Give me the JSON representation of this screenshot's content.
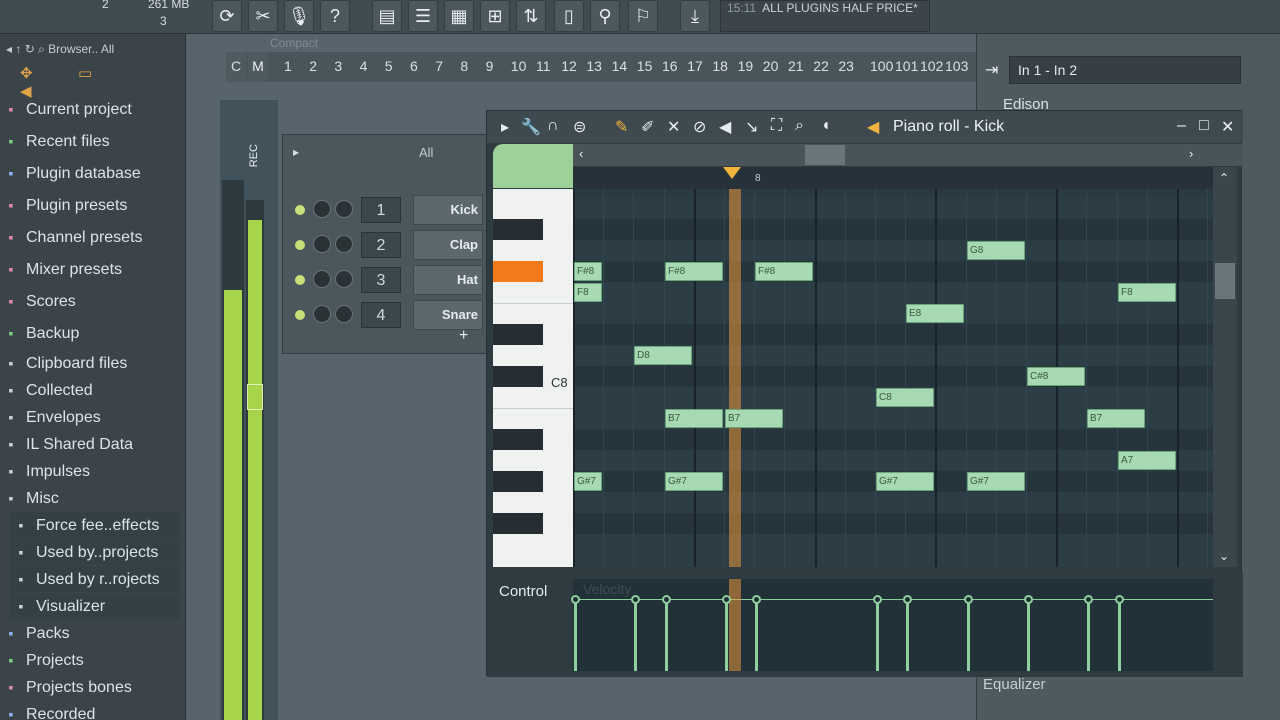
{
  "toolbar": {
    "counter": "2",
    "memory": "261 MB",
    "voices": "3",
    "hint_time": "15:11",
    "hint_text": "ALL PLUGINS HALF PRICE*"
  },
  "browser": {
    "header": "Browser.. All",
    "items": [
      {
        "label": "Current project",
        "icon": "project-icon",
        "color": "#e58aa8"
      },
      {
        "label": "Recent files",
        "icon": "recent-icon",
        "color": "#7fd17f"
      },
      {
        "label": "Plugin database",
        "icon": "plugin-db-icon",
        "color": "#8fb3ff"
      },
      {
        "label": "Plugin presets",
        "icon": "plugin-presets-icon",
        "color": "#e58aa8"
      },
      {
        "label": "Channel presets",
        "icon": "channel-presets-icon",
        "color": "#e58aa8"
      },
      {
        "label": "Mixer presets",
        "icon": "mixer-presets-icon",
        "color": "#e58aa8"
      },
      {
        "label": "Scores",
        "icon": "scores-icon",
        "color": "#e58aa8"
      },
      {
        "label": "Backup",
        "icon": "backup-icon",
        "color": "#7fd17f"
      },
      {
        "label": "Clipboard files",
        "icon": "folder-icon",
        "color": "#c9d3d8"
      },
      {
        "label": "Collected",
        "icon": "folder-icon",
        "color": "#c9d3d8"
      },
      {
        "label": "Envelopes",
        "icon": "folder-icon",
        "color": "#c9d3d8"
      },
      {
        "label": "IL Shared Data",
        "icon": "folder-icon",
        "color": "#c9d3d8"
      },
      {
        "label": "Impulses",
        "icon": "folder-icon",
        "color": "#c9d3d8"
      },
      {
        "label": "Misc",
        "icon": "folder-icon",
        "color": "#c9d3d8"
      }
    ],
    "subitems": [
      {
        "label": "Force fee..effects"
      },
      {
        "label": "Used by..projects"
      },
      {
        "label": "Used by r..rojects"
      },
      {
        "label": "Visualizer"
      }
    ],
    "bottom": [
      {
        "label": "Packs",
        "icon": "packs-icon",
        "color": "#8fb3ff"
      },
      {
        "label": "Projects",
        "icon": "projects-icon",
        "color": "#7fd17f"
      },
      {
        "label": "Projects bones",
        "icon": "projects-bones-icon",
        "color": "#e58aa8"
      },
      {
        "label": "Recorded",
        "icon": "recorded-icon",
        "color": "#8fb3ff"
      }
    ]
  },
  "playlist": {
    "mode": "Compact",
    "bars": [
      "1",
      "2",
      "3",
      "4",
      "5",
      "6",
      "7",
      "8",
      "9",
      "10",
      "11",
      "12",
      "13",
      "14",
      "15",
      "16",
      "17",
      "18",
      "19",
      "20",
      "21",
      "22",
      "23"
    ],
    "bars_right": [
      "100",
      "101",
      "102",
      "103"
    ]
  },
  "channel_rack": {
    "filter": "All",
    "channels": [
      {
        "num": "1",
        "name": "Kick"
      },
      {
        "num": "2",
        "name": "Clap"
      },
      {
        "num": "3",
        "name": "Hat"
      },
      {
        "num": "4",
        "name": "Snare"
      }
    ],
    "add": "+"
  },
  "mixer_strip": {
    "c_label": "C",
    "m_label": "M",
    "rec_label": "REC"
  },
  "piano_roll": {
    "title": "Piano roll - Kick",
    "position_marker": "8",
    "c8_label": "C8",
    "control_label": "Control",
    "control_target": "Velocity"
  },
  "notes": [
    {
      "pitch": "F#8",
      "col": 0,
      "len": 1
    },
    {
      "pitch": "F#8",
      "col": 3,
      "len": 2
    },
    {
      "pitch": "F#8",
      "col": 6,
      "len": 2
    },
    {
      "pitch": "F8",
      "col": 0,
      "len": 1
    },
    {
      "pitch": "G8",
      "col": 13,
      "len": 2
    },
    {
      "pitch": "F8",
      "col": 18,
      "len": 2
    },
    {
      "pitch": "E8",
      "col": 11,
      "len": 2
    },
    {
      "pitch": "D8",
      "col": 2,
      "len": 2
    },
    {
      "pitch": "C#8",
      "col": 15,
      "len": 2
    },
    {
      "pitch": "C8",
      "col": 10,
      "len": 2
    },
    {
      "pitch": "B7",
      "col": 3,
      "len": 2
    },
    {
      "pitch": "B7",
      "col": 5,
      "len": 2
    },
    {
      "pitch": "B7",
      "col": 17,
      "len": 2
    },
    {
      "pitch": "A7",
      "col": 18,
      "len": 2
    },
    {
      "pitch": "G#7",
      "col": 0,
      "len": 1
    },
    {
      "pitch": "G#7",
      "col": 3,
      "len": 2
    },
    {
      "pitch": "G#7",
      "col": 10,
      "len": 2
    },
    {
      "pitch": "G#7",
      "col": 13,
      "len": 2
    }
  ],
  "mixer": {
    "route": "In 1 - In 2",
    "slot": "Edison",
    "eq": "Equalizer"
  },
  "colors": {
    "accent": "#f2b43c",
    "note": "#a7d9b2",
    "meter": "#a7d44a"
  }
}
